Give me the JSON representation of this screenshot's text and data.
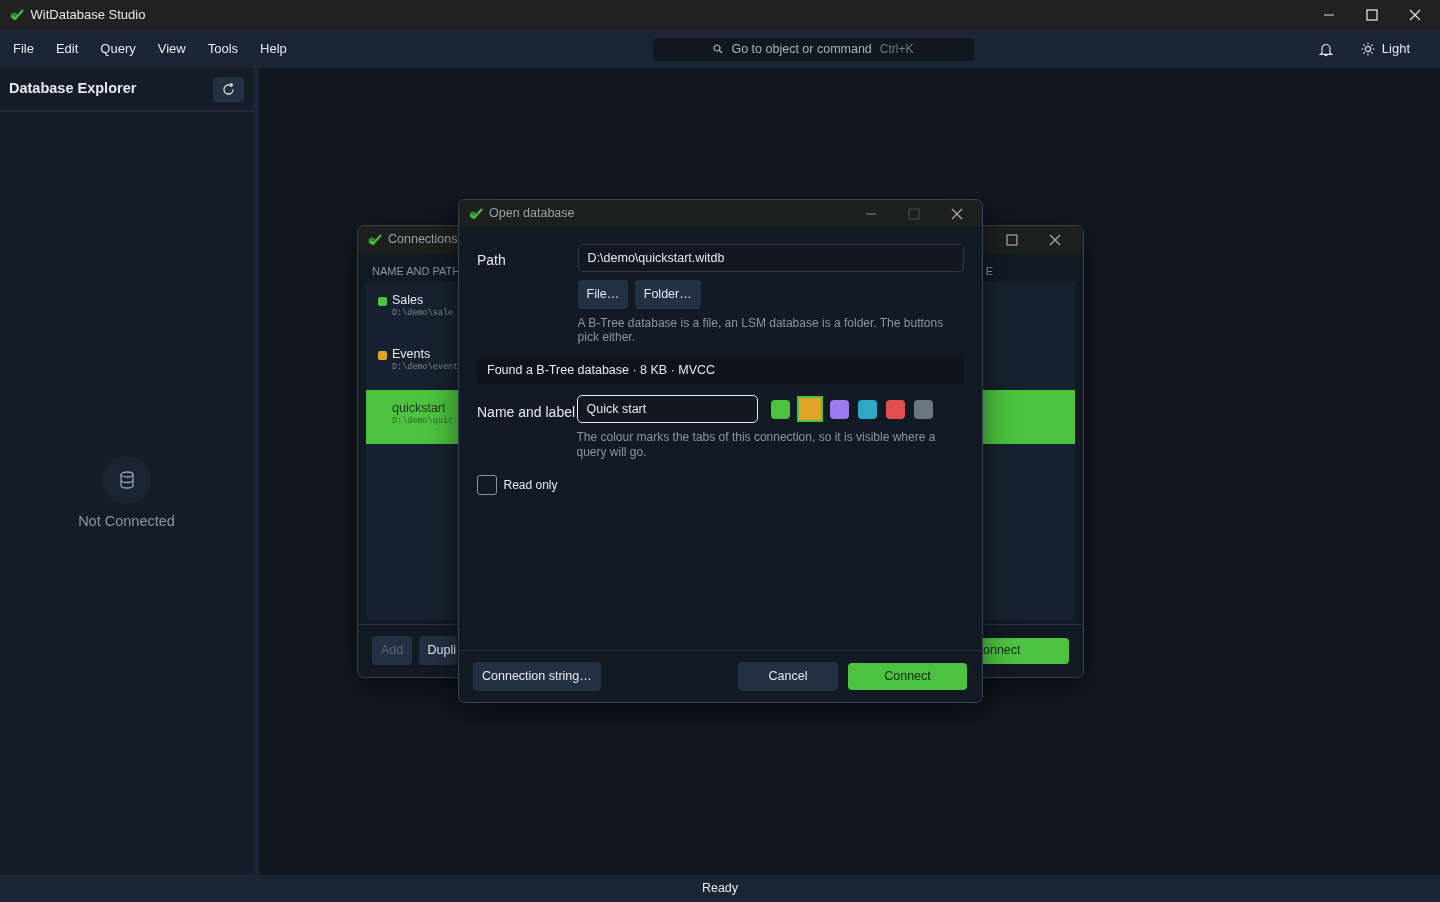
{
  "app": {
    "title": "WitDatabase Studio"
  },
  "menu": [
    "File",
    "Edit",
    "Query",
    "View",
    "Tools",
    "Help"
  ],
  "command_search": {
    "placeholder": "Go to object or command",
    "shortcut": "Ctrl+K"
  },
  "theme_toggle": {
    "label": "Light"
  },
  "sidebar": {
    "title": "Database Explorer",
    "empty_text": "Not Connected"
  },
  "connections_window": {
    "title": "Connections",
    "column_1": "NAME AND PATH",
    "column_2": "E",
    "items": [
      {
        "name": "Sales",
        "path": "D:\\demo\\sale",
        "color": "#4cc23f",
        "selected": false
      },
      {
        "name": "Events",
        "path": "D:\\demo\\event",
        "color": "#e0a526",
        "selected": false
      },
      {
        "name": "quickstart",
        "path": "D:\\demo\\quic",
        "selected": true
      }
    ],
    "buttons": [
      {
        "label": "Add",
        "disabled": true
      },
      {
        "label": "Dupli",
        "disabled": false
      }
    ],
    "connect_button": "onnect"
  },
  "dialog": {
    "title": "Open database",
    "maximize_disabled": true,
    "path_label": "Path",
    "path": "D:\\demo\\quickstart.witdb",
    "browse_buttons": [
      "File…",
      "Folder…"
    ],
    "path_hint": "A B-Tree database is a file, an LSM database is a folder. The buttons pick either.",
    "detected": "Found a B-Tree database · 8 KB · MVCC",
    "name_label": "Name and label",
    "name": "Quick start",
    "swatches": [
      {
        "color": "#4cc23f",
        "selected": false
      },
      {
        "color": "#e0a526",
        "selected": true
      },
      {
        "color": "#9b7cf0",
        "selected": false
      },
      {
        "color": "#2fa8c6",
        "selected": false
      },
      {
        "color": "#e0504e",
        "selected": false
      },
      {
        "color": "#6b7584",
        "selected": false
      }
    ],
    "name_hint": "The colour marks the tabs of this connection, so it is visible where a query will go.",
    "read_only": {
      "label": "Read only",
      "checked": false
    },
    "connection_string_button": "Connection string…",
    "cancel_button": "Cancel",
    "connect_button": "Connect"
  },
  "status_bar": "Ready"
}
